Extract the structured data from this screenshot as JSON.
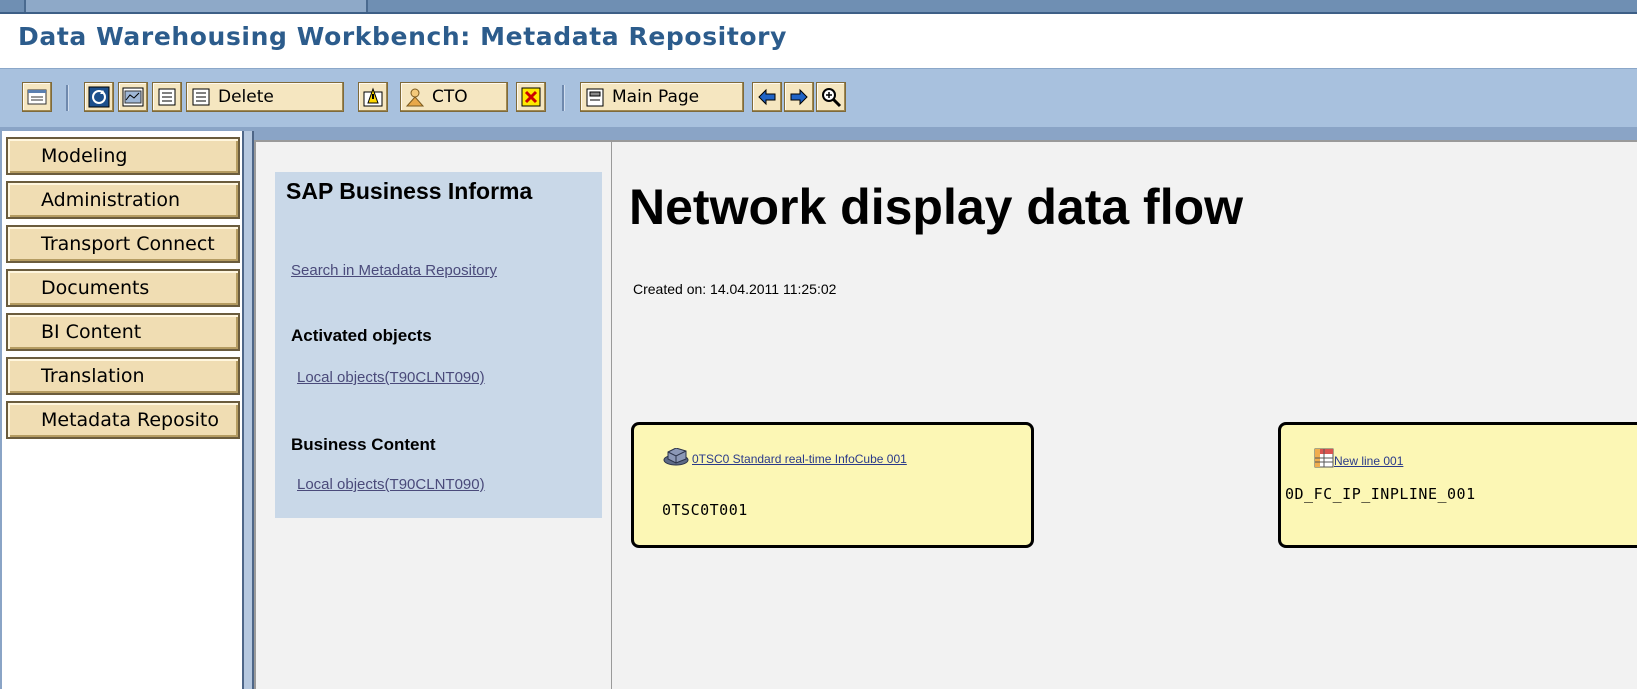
{
  "title": "Data Warehousing Workbench: Metadata Repository",
  "toolbar": {
    "delete_label": "Delete",
    "cto_label": "CTO",
    "main_page_label": "Main Page"
  },
  "nav": {
    "items": [
      {
        "label": "Modeling"
      },
      {
        "label": "Administration"
      },
      {
        "label": "Transport Connect"
      },
      {
        "label": "Documents"
      },
      {
        "label": "BI Content"
      },
      {
        "label": "Translation"
      },
      {
        "label": "Metadata Reposito"
      }
    ]
  },
  "panel": {
    "heading": "SAP Business Informa",
    "search_link": "Search in Metadata Repository",
    "section_activated": "Activated objects",
    "activated_link": "Local objects(T90CLNT090)",
    "section_business": "Business Content",
    "business_link": "Local objects(T90CLNT090)"
  },
  "main": {
    "heading": "Network display data flow",
    "created": "Created on: 14.04.2011 11:25:02",
    "nodes": [
      {
        "link": "0TSC0 Standard real-time InfoCube 001",
        "id": "0TSC0T001",
        "icon": "infocube-icon"
      },
      {
        "link": "New line 001",
        "id": "0D_FC_IP_INPLINE_001",
        "icon": "table-icon"
      }
    ]
  },
  "colors": {
    "title": "#2c5c8c",
    "toolbar": "#a8c1de",
    "nav_button": "#f0ddb3",
    "panel": "#c9d8e8",
    "node": "#fcf7b5"
  }
}
